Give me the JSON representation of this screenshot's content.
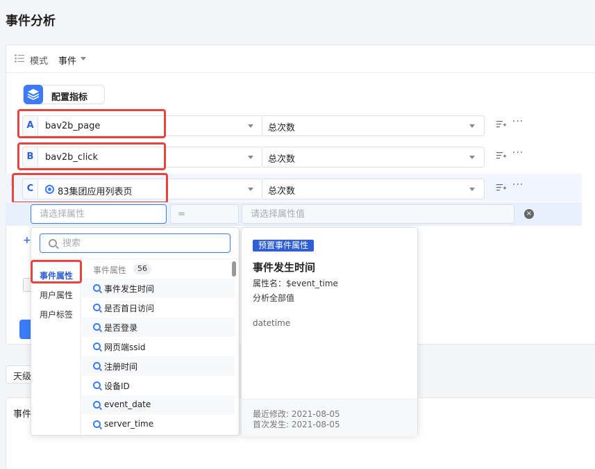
{
  "page": {
    "title": "事件分析"
  },
  "mode": {
    "label": "模式",
    "value": "事件"
  },
  "config": {
    "label": "配置指标"
  },
  "metrics": [
    {
      "letter": "A",
      "event": "bav2b_page",
      "metric": "总次数",
      "virtual": false
    },
    {
      "letter": "B",
      "event": "bav2b_click",
      "metric": "总次数",
      "virtual": false
    },
    {
      "letter": "C",
      "event": "83集团应用列表页",
      "metric": "总次数",
      "virtual": true
    }
  ],
  "filter": {
    "property_placeholder": "请选择属性",
    "operator": "=",
    "value_placeholder": "请选择属性值"
  },
  "dropdown": {
    "search_placeholder": "搜索",
    "categories": [
      {
        "label": "事件属性",
        "active": true
      },
      {
        "label": "用户属性",
        "active": false
      },
      {
        "label": "用户标签",
        "active": false
      }
    ],
    "list_header": "事件属性",
    "count": "56",
    "items": [
      {
        "label": "事件发生时间",
        "hover": true
      },
      {
        "label": "是否首日访问",
        "hover": false
      },
      {
        "label": "是否登录",
        "hover": false
      },
      {
        "label": "网页端ssid",
        "hover": false
      },
      {
        "label": "注册时间",
        "hover": false
      },
      {
        "label": "设备ID",
        "hover": false
      },
      {
        "label": "event_date",
        "hover": false
      },
      {
        "label": "server_time",
        "hover": false
      }
    ]
  },
  "detail": {
    "tag": "预置事件属性",
    "title": "事件发生时间",
    "name_line": "属性名：$event_time",
    "scope": "分析全部值",
    "type": "datetime",
    "modified": "最近修改: 2021-08-05",
    "first_seen": "首次发生: 2021-08-05"
  },
  "bottom": {
    "granularity": "天级",
    "result_title": "事件"
  },
  "colors": {
    "accent": "#3b7cf6",
    "highlight": "#e5453f"
  }
}
